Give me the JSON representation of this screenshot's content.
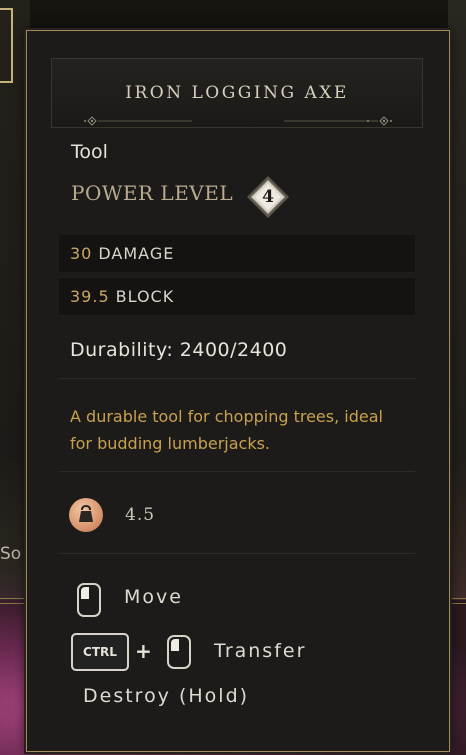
{
  "background": {
    "sort_label": "So"
  },
  "tooltip": {
    "item_name": "IRON LOGGING AXE",
    "item_type": "Tool",
    "power_level_label": "POWER LEVEL",
    "power_level_value": "4",
    "stats": [
      {
        "value": "30",
        "name": "DAMAGE"
      },
      {
        "value": "39.5",
        "name": "BLOCK"
      }
    ],
    "durability": "Durability: 2400/2400",
    "description": "A durable tool for chopping trees, ideal for budding lumberjacks.",
    "weight_icon": "weight-icon",
    "weight": "4.5",
    "actions": {
      "move_label": "Move",
      "ctrl_key": "CTRL",
      "plus": "+",
      "transfer_label": "Transfer",
      "destroy_label": "Destroy (Hold)"
    }
  },
  "colors": {
    "border_gold": "#a38c5a",
    "stat_value": "#c9a765",
    "description_text": "#c8a14f"
  }
}
